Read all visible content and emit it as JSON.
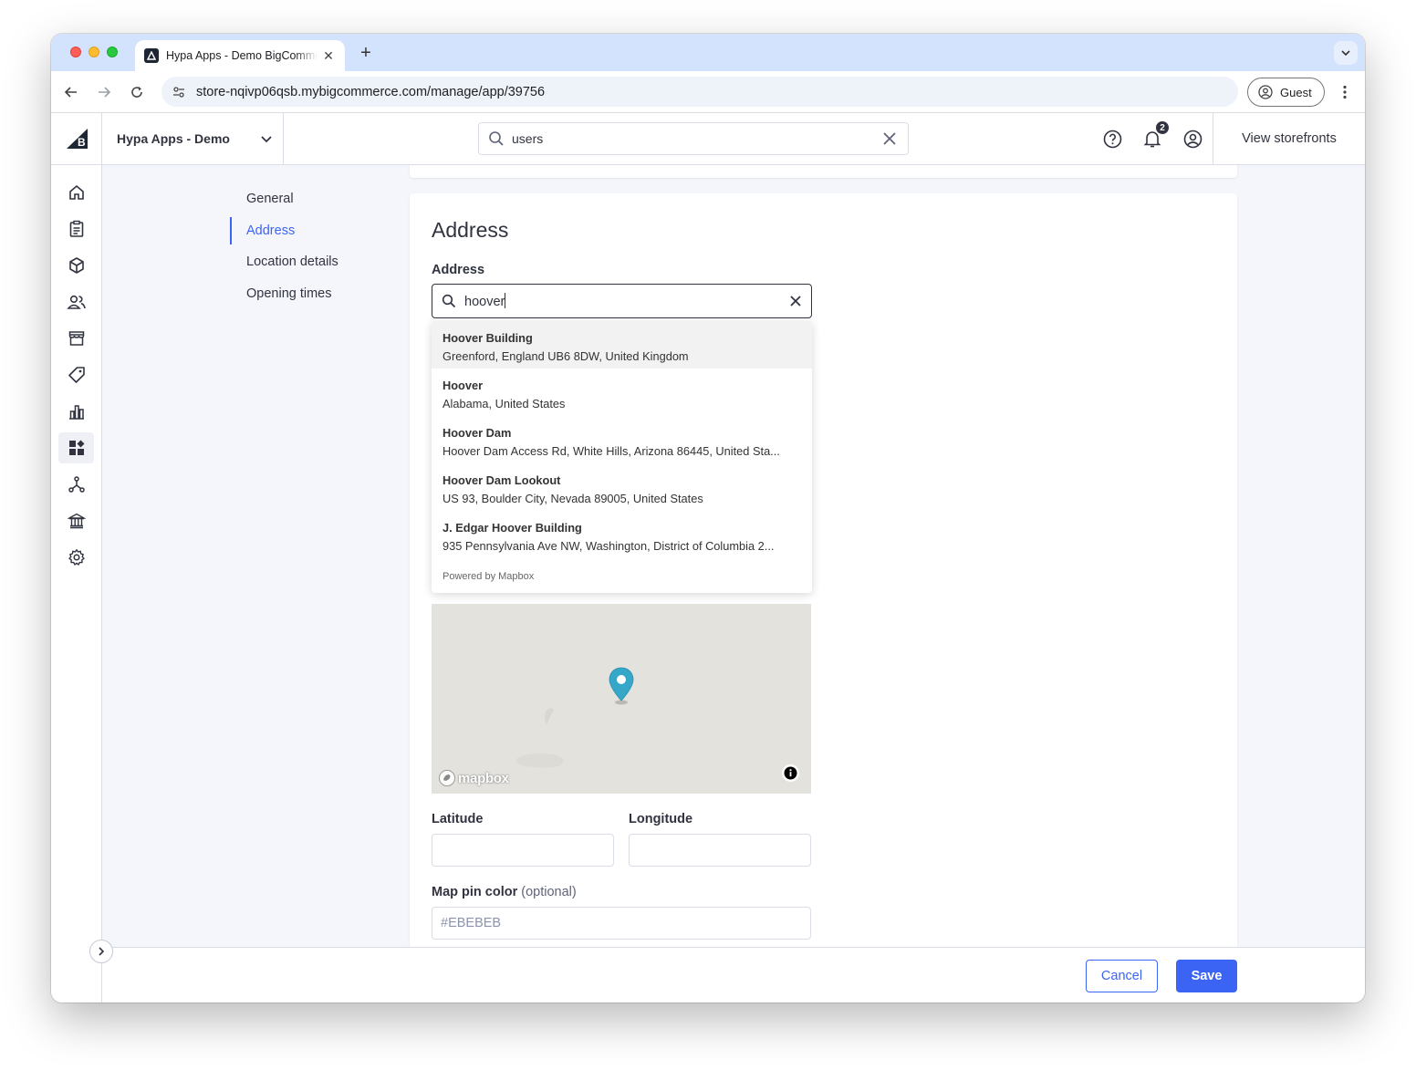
{
  "browser": {
    "tab_title": "Hypa Apps - Demo BigCommerce",
    "url": "store-nqivp06qsb.mybigcommerce.com/manage/app/39756",
    "profile_label": "Guest"
  },
  "header": {
    "store_name": "Hypa Apps - Demo",
    "search_value": "users",
    "notification_count": "2",
    "view_storefronts": "View storefronts"
  },
  "sidebar": {
    "icons": [
      "home-icon",
      "orders-icon",
      "products-icon",
      "customers-icon",
      "storefront-icon",
      "marketing-icon",
      "analytics-icon",
      "apps-icon",
      "channels-icon",
      "finance-icon",
      "settings-icon"
    ],
    "active_index": 7
  },
  "subnav": {
    "items": [
      {
        "label": "General"
      },
      {
        "label": "Address"
      },
      {
        "label": "Location details"
      },
      {
        "label": "Opening times"
      }
    ],
    "active": "Address"
  },
  "address_section": {
    "title": "Address",
    "field_label": "Address",
    "field_value": "hoover",
    "suggestions": [
      {
        "title": "Hoover Building",
        "subtitle": "Greenford, England UB6 8DW, United Kingdom"
      },
      {
        "title": "Hoover",
        "subtitle": "Alabama, United States"
      },
      {
        "title": "Hoover Dam",
        "subtitle": "Hoover Dam Access Rd, White Hills, Arizona 86445, United Sta..."
      },
      {
        "title": "Hoover Dam Lookout",
        "subtitle": "US 93, Boulder City, Nevada 89005, United States"
      },
      {
        "title": "J. Edgar Hoover Building",
        "subtitle": "935 Pennsylvania Ave NW, Washington, District of Columbia 2..."
      }
    ],
    "powered_by": "Powered by Mapbox",
    "map_logo_text": "mapbox",
    "latitude_label": "Latitude",
    "latitude_value": "",
    "longitude_label": "Longitude",
    "longitude_value": "",
    "pin_color_label": "Map pin color",
    "pin_color_optional": "(optional)",
    "pin_color_placeholder": "#EBEBEB"
  },
  "footer": {
    "cancel_label": "Cancel",
    "save_label": "Save"
  },
  "colors": {
    "primary": "#3c64f4",
    "pin": "#35a8c9",
    "map_bg": "#e3e2dd"
  }
}
